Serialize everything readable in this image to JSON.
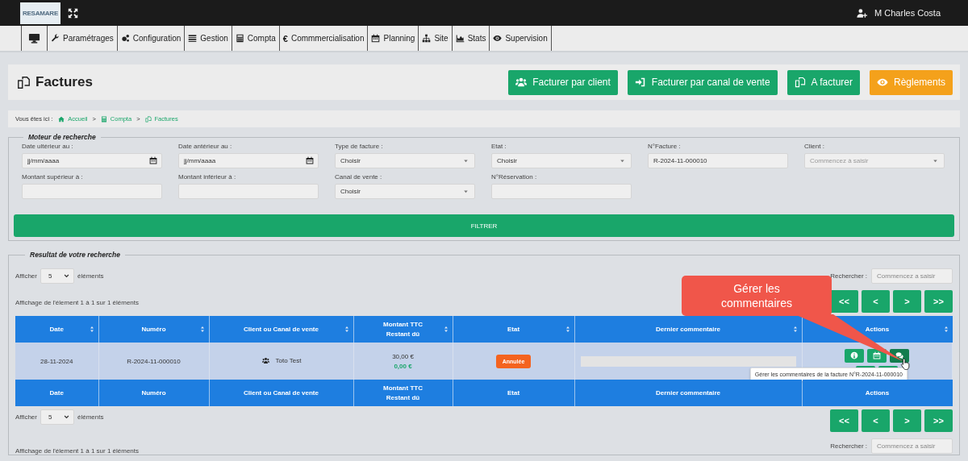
{
  "topbar": {
    "logo": "RESAMARE",
    "user": "M Charles Costa"
  },
  "nav": {
    "items": [
      {
        "label": "Paramétrages"
      },
      {
        "label": "Configuration"
      },
      {
        "label": "Gestion"
      },
      {
        "label": "Compta"
      },
      {
        "label": "Commmercialisation",
        "glyph": "€"
      },
      {
        "label": "Planning"
      },
      {
        "label": "Site"
      },
      {
        "label": "Stats"
      },
      {
        "label": "Supervision"
      }
    ]
  },
  "page": {
    "title": "Factures",
    "buttons": [
      {
        "label": "Facturer par client",
        "kind": "primary"
      },
      {
        "label": "Facturer par canal de vente",
        "kind": "primary"
      },
      {
        "label": "A facturer",
        "kind": "primary"
      },
      {
        "label": "Règlements",
        "kind": "warning"
      }
    ]
  },
  "breadcrumb": {
    "prefix": "Vous êtes ici :",
    "separator": ">",
    "items": [
      "Accueil",
      "Compta",
      "Factures"
    ]
  },
  "search": {
    "legend": "Moteur de recherche",
    "fields": [
      {
        "label": "Date ultérieur au :",
        "kind": "date",
        "placeholder": "jj/mm/aaaa"
      },
      {
        "label": "Date antérieur au :",
        "kind": "date",
        "placeholder": "jj/mm/aaaa"
      },
      {
        "label": "Type de facture :",
        "kind": "select",
        "value": "Choisir"
      },
      {
        "label": "Etat :",
        "kind": "select",
        "value": "Choisir"
      },
      {
        "label": "N°Facture :",
        "kind": "text",
        "value": "R-2024-11-000010"
      },
      {
        "label": "Client :",
        "kind": "select",
        "placeholder": "Commencez à saisir"
      },
      {
        "label": "Montant supérieur à :",
        "kind": "text"
      },
      {
        "label": "Montant inférieur à :",
        "kind": "text"
      },
      {
        "label": "Canal de vente :",
        "kind": "select",
        "value": "Choisir"
      },
      {
        "label": "N°Réservation :",
        "kind": "text"
      }
    ],
    "submit": "FILTRER"
  },
  "results": {
    "legend": "Resultat de votre recherche",
    "top_controls": {
      "show_before": "Afficher",
      "show_value": "5",
      "show_after": "éléments",
      "search_label": "Rechercher :",
      "search_placeholder": "Commencez a saisir",
      "pager": [
        "<<",
        "<",
        ">",
        ">>"
      ],
      "info": "Affichage de l'élement 1 à 1 sur 1 éléments"
    },
    "table": {
      "columns": [
        {
          "label": "Date",
          "sortable": true
        },
        {
          "label": "Numéro",
          "sortable": true
        },
        {
          "label": "Client ou Canal de vente",
          "sortable": true
        },
        {
          "label": "Montant TTC\nRestant dû",
          "sortable": true
        },
        {
          "label": "Etat",
          "sortable": true
        },
        {
          "label": "Dernier commentaire",
          "sortable": true
        },
        {
          "label": "Actions",
          "sortable": true
        }
      ],
      "rows": [
        {
          "date": "28-11-2024",
          "number": "R-2024-11-000010",
          "client": "Toto Test",
          "amount": "30,00 €",
          "remaining": "0,00 €",
          "status": {
            "label": "Annulée",
            "color": "#f4631f"
          },
          "actions": [
            {
              "kind": "info",
              "hovered": false
            },
            {
              "kind": "calendar",
              "hovered": false
            },
            {
              "kind": "comments",
              "hovered": true
            },
            {
              "kind": "plain",
              "hovered": false
            },
            {
              "kind": "plain",
              "hovered": false
            }
          ],
          "tooltip": "Gérer les commentaires de la facture N°R-2024-11-000010"
        }
      ],
      "footer_columns": [
        "Date",
        "Numéro",
        "Client ou Canal de vente",
        "Montant TTC\nRestant dû",
        "Etat",
        "Dernier commentaire",
        "Actions"
      ]
    },
    "bottom_controls": {
      "show_before": "Afficher",
      "show_value": "5",
      "show_after": "éléments",
      "search_label": "Rechercher :",
      "search_placeholder": "Commencez a saisir",
      "pager": [
        "<<",
        "<",
        ">",
        ">>"
      ],
      "info": "Affichage de l'élement 1 à 1 sur 1 éléments"
    }
  },
  "callout": {
    "text": "Gérer les commentaires"
  }
}
